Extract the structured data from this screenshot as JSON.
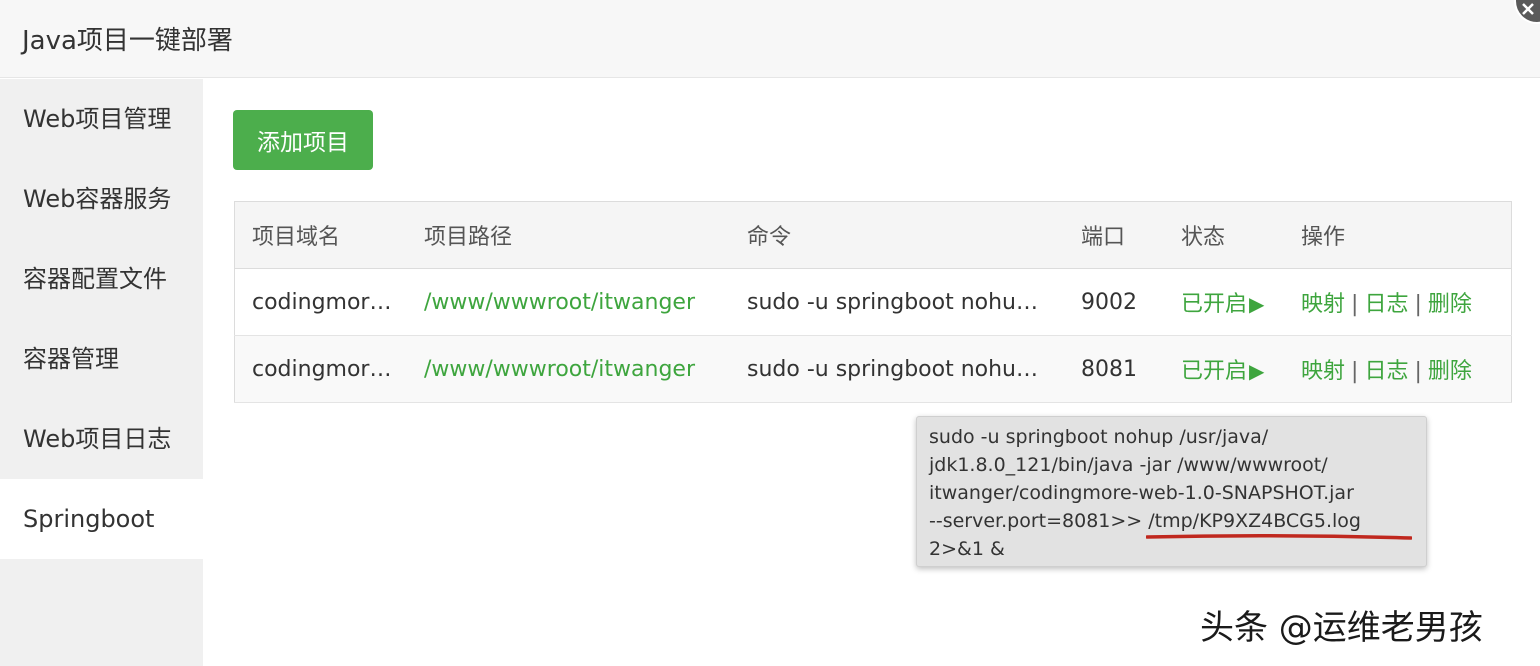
{
  "window": {
    "title": "Java项目一键部署"
  },
  "sidebar": {
    "items": [
      {
        "label": "Web项目管理"
      },
      {
        "label": "Web容器服务"
      },
      {
        "label": "容器配置文件"
      },
      {
        "label": "容器管理"
      },
      {
        "label": "Web项目日志"
      },
      {
        "label": "Springboot",
        "active": true
      }
    ]
  },
  "main": {
    "add_button": "添加项目",
    "table": {
      "columns": [
        "项目域名",
        "项目路径",
        "命令",
        "端口",
        "状态",
        "操作"
      ],
      "rows": [
        {
          "domain": "codingmor…",
          "path": "/www/wwwroot/itwanger",
          "command": "sudo -u springboot nohup…",
          "port": "9002",
          "status": "已开启",
          "actions": [
            "映射",
            "日志",
            "删除"
          ]
        },
        {
          "domain": "codingmor…",
          "path": "/www/wwwroot/itwanger",
          "command": "sudo -u springboot nohup…",
          "port": "8081",
          "status": "已开启",
          "actions": [
            "映射",
            "日志",
            "删除"
          ]
        }
      ],
      "separator": "|"
    }
  },
  "tooltip": {
    "lines": [
      "sudo -u springboot nohup /usr/java/",
      "jdk1.8.0_121/bin/java -jar /www/wwwroot/",
      "itwanger/codingmore-web-1.0-SNAPSHOT.jar",
      "--server.port=8081>> /tmp/KP9XZ4BCG5.log",
      "2>&1 &"
    ]
  },
  "watermark": "头条 @运维老男孩",
  "colors": {
    "accent_green": "#3ea53e",
    "button_green": "#4cae4c",
    "underline_red": "#c0281e"
  },
  "icons": {
    "status": "play-triangle-icon",
    "close": "close-icon"
  }
}
